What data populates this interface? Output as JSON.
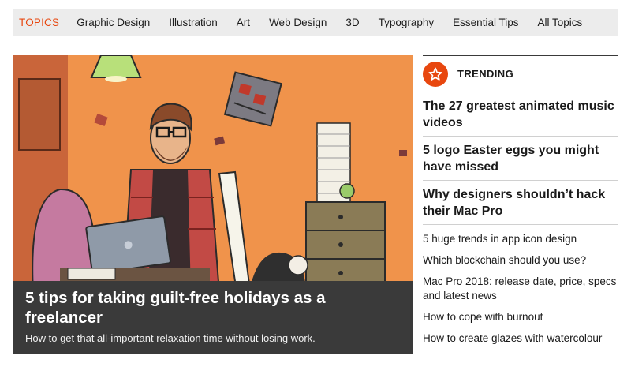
{
  "topnav": {
    "label": "TOPICS",
    "items": [
      "Graphic Design",
      "Illustration",
      "Art",
      "Web Design",
      "3D",
      "Typography",
      "Essential Tips",
      "All Topics"
    ]
  },
  "hero": {
    "title": "5 tips for taking guilt-free holidays as a freelancer",
    "subtitle": "How to get that all-important relaxation time without losing work."
  },
  "trending": {
    "label": "TRENDING",
    "icon": "star-icon",
    "accent": "#e8470f",
    "featured": [
      "The 27 greatest animated music videos",
      "5 logo Easter eggs you might have missed",
      "Why designers shouldn’t hack their Mac Pro"
    ],
    "list": [
      "5 huge trends in app icon design",
      "Which blockchain should you use?",
      "Mac Pro 2018: release date, price, specs and latest news",
      "How to cope with burnout",
      "How to create glazes with watercolour"
    ]
  }
}
